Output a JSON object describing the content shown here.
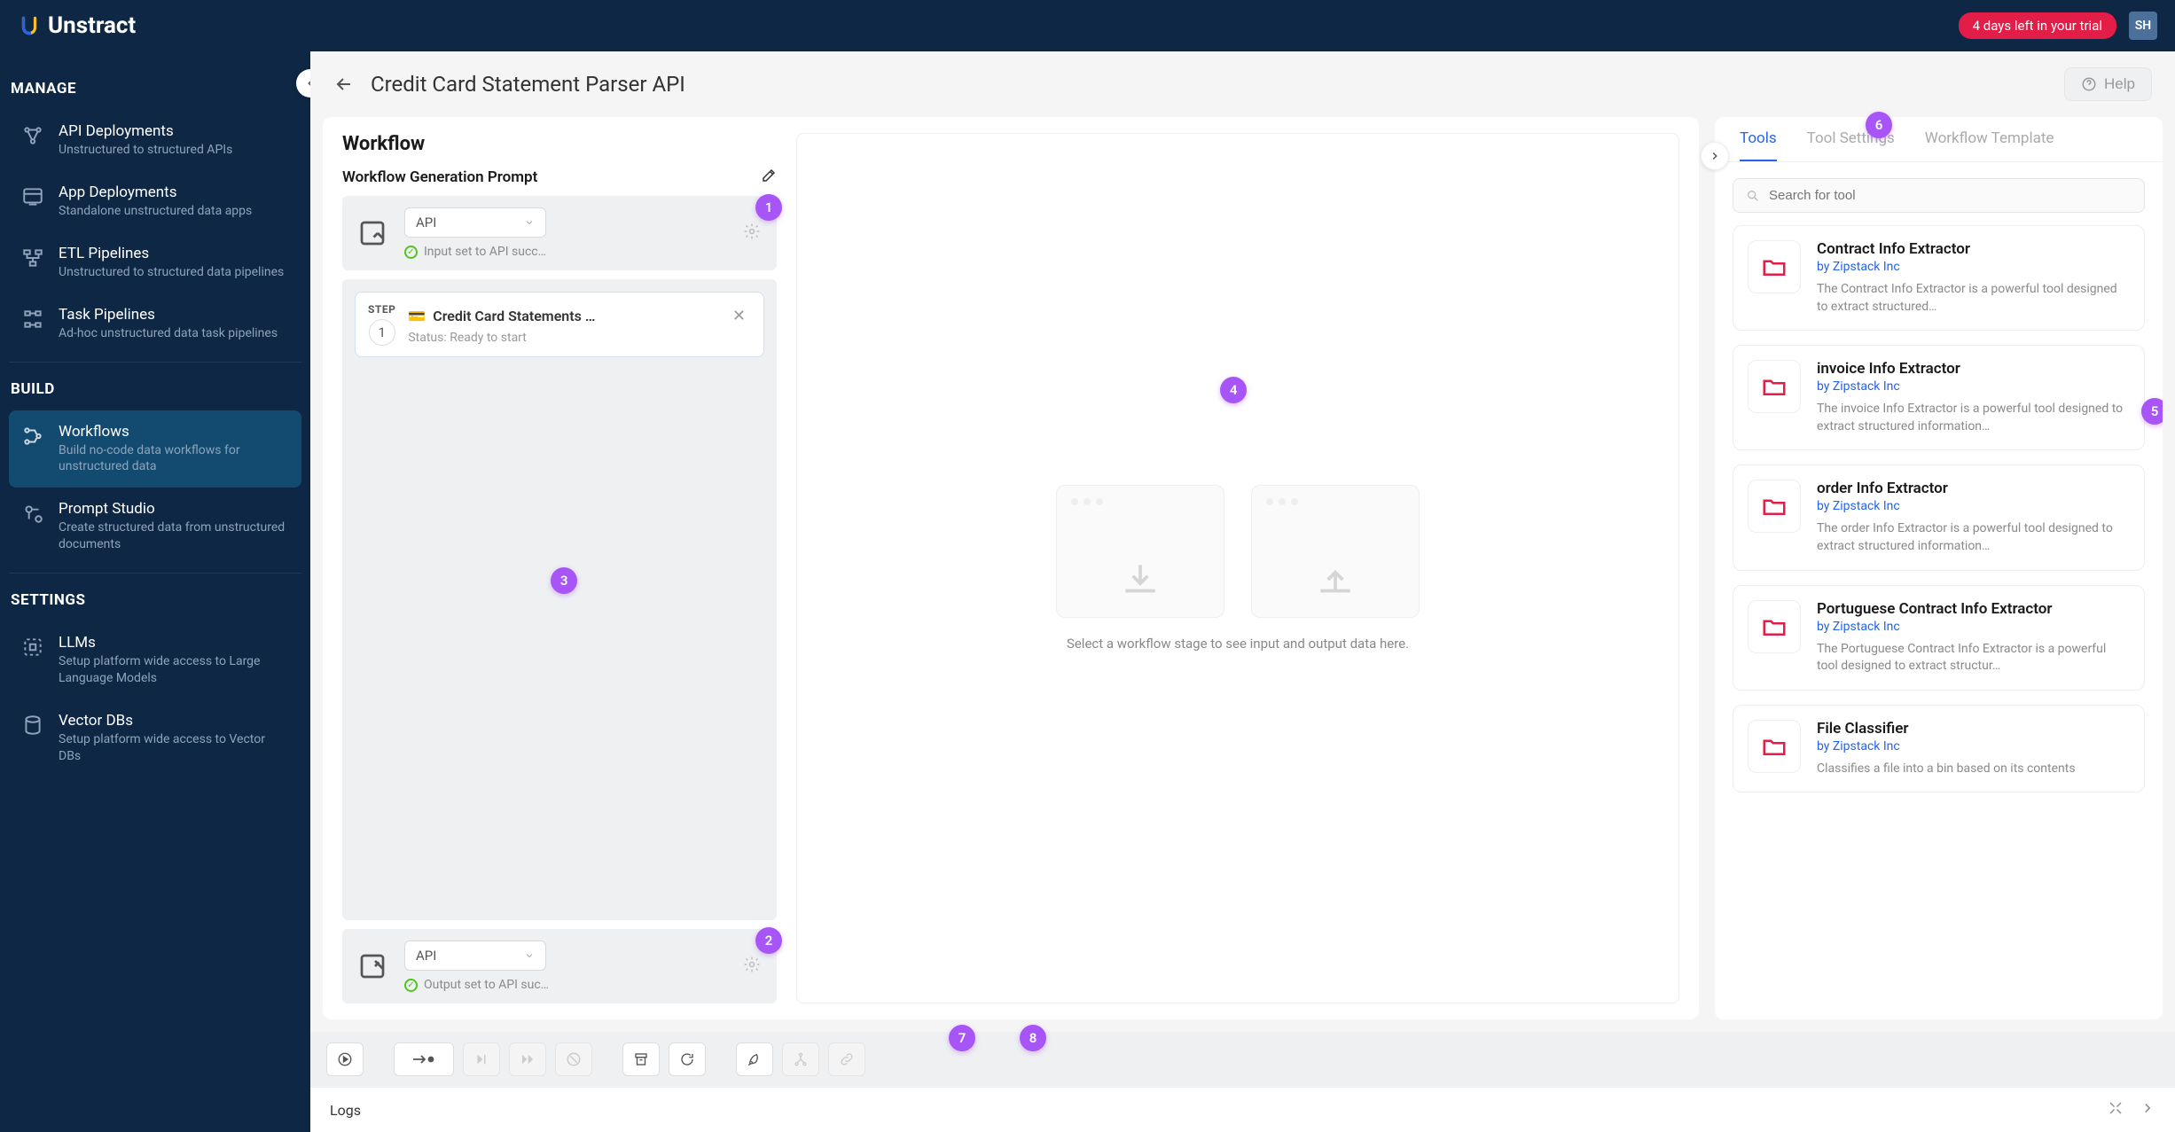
{
  "topbar": {
    "brand": "Unstract",
    "trial": "4 days left in your trial",
    "avatar": "SH"
  },
  "sidebar": {
    "manage_label": "MANAGE",
    "build_label": "BUILD",
    "settings_label": "SETTINGS",
    "items": {
      "api_deployments": {
        "title": "API Deployments",
        "sub": "Unstructured to structured APIs"
      },
      "app_deployments": {
        "title": "App Deployments",
        "sub": "Standalone unstructured data apps"
      },
      "etl_pipelines": {
        "title": "ETL Pipelines",
        "sub": "Unstructured to structured data pipelines"
      },
      "task_pipelines": {
        "title": "Task Pipelines",
        "sub": "Ad-hoc unstructured data task pipelines"
      },
      "workflows": {
        "title": "Workflows",
        "sub": "Build no-code data workflows for unstructured data"
      },
      "prompt_studio": {
        "title": "Prompt Studio",
        "sub": "Create structured data from unstructured documents"
      },
      "llms": {
        "title": "LLMs",
        "sub": "Setup platform wide access to Large Language Models"
      },
      "vector_dbs": {
        "title": "Vector DBs",
        "sub": "Setup platform wide access to Vector DBs"
      }
    }
  },
  "header": {
    "title": "Credit Card Statement Parser API",
    "help": "Help"
  },
  "workflow": {
    "title": "Workflow",
    "prompt_label": "Workflow Generation Prompt",
    "input": {
      "select": "API",
      "status": "Input set to API succ…"
    },
    "output": {
      "select": "API",
      "status": "Output set to API suc…"
    },
    "step": {
      "label": "STEP",
      "num": "1",
      "name": "Credit Card Statements …",
      "status": "Status: Ready to start"
    },
    "preview_text": "Select a workflow stage to see input and output data here."
  },
  "right": {
    "tabs": {
      "tools": "Tools",
      "settings": "Tool Settings",
      "template": "Workflow Template"
    },
    "search_placeholder": "Search for tool",
    "tools": [
      {
        "title": "Contract Info Extractor",
        "by": "by Zipstack Inc",
        "desc": "The Contract Info Extractor is a powerful tool designed to extract structured…"
      },
      {
        "title": "invoice Info Extractor",
        "by": "by Zipstack Inc",
        "desc": "The invoice Info Extractor is a powerful tool designed to extract structured information…"
      },
      {
        "title": "order Info Extractor",
        "by": "by Zipstack Inc",
        "desc": "The order Info Extractor is a powerful tool designed to extract structured information…"
      },
      {
        "title": "Portuguese Contract Info Extractor",
        "by": "by Zipstack Inc",
        "desc": "The Portuguese Contract Info Extractor is a powerful tool designed to extract structur…"
      },
      {
        "title": "File Classifier",
        "by": "by Zipstack Inc",
        "desc": "Classifies a file into a bin based on its contents"
      }
    ]
  },
  "bubbles": {
    "b1": "1",
    "b2": "2",
    "b3": "3",
    "b4": "4",
    "b5": "5",
    "b6": "6",
    "b7": "7",
    "b8": "8"
  },
  "logs": {
    "label": "Logs"
  }
}
